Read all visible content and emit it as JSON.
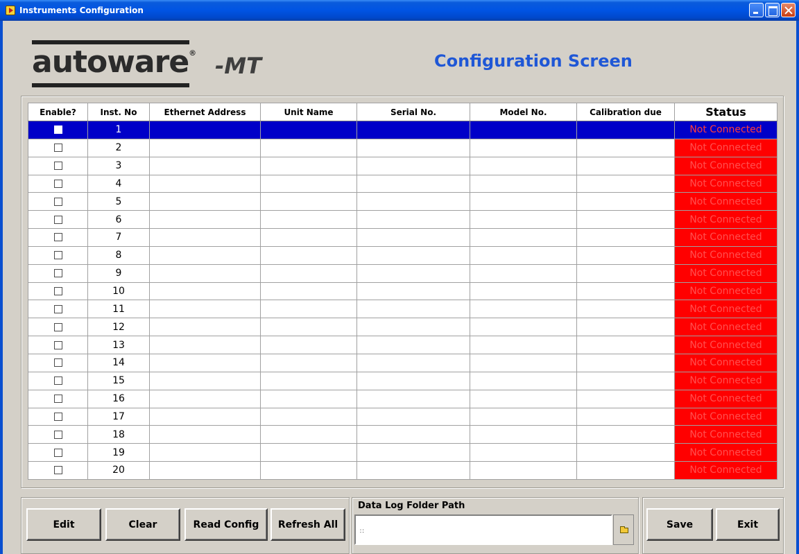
{
  "window": {
    "title": "Instruments Configuration"
  },
  "header": {
    "brand": "autoware",
    "brand_sub": "-MT",
    "registered": "®",
    "screen_title": "Configuration Screen"
  },
  "table": {
    "columns": [
      "Enable?",
      "Inst. No",
      "Ethernet Address",
      "Unit Name",
      "Serial No.",
      "Model No.",
      "Calibration due",
      "Status"
    ],
    "selected_row": 0,
    "status_colors": {
      "not_connected_bg": "#ff0000",
      "selected_bg": "#0000c8"
    },
    "rows": [
      {
        "inst_no": "1",
        "ethernet": "",
        "unit": "",
        "serial": "",
        "model": "",
        "calibration": "",
        "status": "Not Connected",
        "enabled": false
      },
      {
        "inst_no": "2",
        "ethernet": "",
        "unit": "",
        "serial": "",
        "model": "",
        "calibration": "",
        "status": "Not Connected",
        "enabled": false
      },
      {
        "inst_no": "3",
        "ethernet": "",
        "unit": "",
        "serial": "",
        "model": "",
        "calibration": "",
        "status": "Not Connected",
        "enabled": false
      },
      {
        "inst_no": "4",
        "ethernet": "",
        "unit": "",
        "serial": "",
        "model": "",
        "calibration": "",
        "status": "Not Connected",
        "enabled": false
      },
      {
        "inst_no": "5",
        "ethernet": "",
        "unit": "",
        "serial": "",
        "model": "",
        "calibration": "",
        "status": "Not Connected",
        "enabled": false
      },
      {
        "inst_no": "6",
        "ethernet": "",
        "unit": "",
        "serial": "",
        "model": "",
        "calibration": "",
        "status": "Not Connected",
        "enabled": false
      },
      {
        "inst_no": "7",
        "ethernet": "",
        "unit": "",
        "serial": "",
        "model": "",
        "calibration": "",
        "status": "Not Connected",
        "enabled": false
      },
      {
        "inst_no": "8",
        "ethernet": "",
        "unit": "",
        "serial": "",
        "model": "",
        "calibration": "",
        "status": "Not Connected",
        "enabled": false
      },
      {
        "inst_no": "9",
        "ethernet": "",
        "unit": "",
        "serial": "",
        "model": "",
        "calibration": "",
        "status": "Not Connected",
        "enabled": false
      },
      {
        "inst_no": "10",
        "ethernet": "",
        "unit": "",
        "serial": "",
        "model": "",
        "calibration": "",
        "status": "Not Connected",
        "enabled": false
      },
      {
        "inst_no": "11",
        "ethernet": "",
        "unit": "",
        "serial": "",
        "model": "",
        "calibration": "",
        "status": "Not Connected",
        "enabled": false
      },
      {
        "inst_no": "12",
        "ethernet": "",
        "unit": "",
        "serial": "",
        "model": "",
        "calibration": "",
        "status": "Not Connected",
        "enabled": false
      },
      {
        "inst_no": "13",
        "ethernet": "",
        "unit": "",
        "serial": "",
        "model": "",
        "calibration": "",
        "status": "Not Connected",
        "enabled": false
      },
      {
        "inst_no": "14",
        "ethernet": "",
        "unit": "",
        "serial": "",
        "model": "",
        "calibration": "",
        "status": "Not Connected",
        "enabled": false
      },
      {
        "inst_no": "15",
        "ethernet": "",
        "unit": "",
        "serial": "",
        "model": "",
        "calibration": "",
        "status": "Not Connected",
        "enabled": false
      },
      {
        "inst_no": "16",
        "ethernet": "",
        "unit": "",
        "serial": "",
        "model": "",
        "calibration": "",
        "status": "Not Connected",
        "enabled": false
      },
      {
        "inst_no": "17",
        "ethernet": "",
        "unit": "",
        "serial": "",
        "model": "",
        "calibration": "",
        "status": "Not Connected",
        "enabled": false
      },
      {
        "inst_no": "18",
        "ethernet": "",
        "unit": "",
        "serial": "",
        "model": "",
        "calibration": "",
        "status": "Not Connected",
        "enabled": false
      },
      {
        "inst_no": "19",
        "ethernet": "",
        "unit": "",
        "serial": "",
        "model": "",
        "calibration": "",
        "status": "Not Connected",
        "enabled": false
      },
      {
        "inst_no": "20",
        "ethernet": "",
        "unit": "",
        "serial": "",
        "model": "",
        "calibration": "",
        "status": "Not Connected",
        "enabled": false
      }
    ]
  },
  "controls": {
    "edit_label": "Edit",
    "clear_label": "Clear",
    "read_config_label": "Read Config",
    "refresh_all_label": "Refresh All",
    "data_log_label": "Data Log Folder Path",
    "data_log_value": "",
    "save_label": "Save",
    "exit_label": "Exit"
  }
}
